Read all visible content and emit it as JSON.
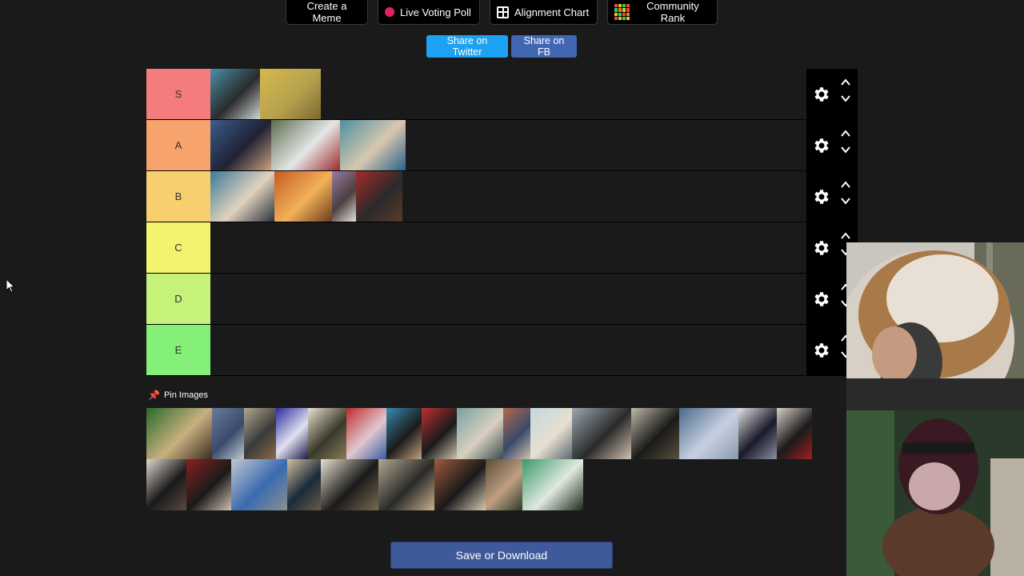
{
  "nav": [
    {
      "label": "Create a Meme",
      "icon": "none"
    },
    {
      "label": "Live Voting Poll",
      "icon": "record-dot-icon"
    },
    {
      "label": "Alignment Chart",
      "icon": "grid-icon"
    },
    {
      "label": "Community Rank",
      "icon": "mosaic-icon"
    }
  ],
  "share": {
    "twitter": "Share on Twitter",
    "facebook": "Share on FB"
  },
  "tiers": [
    {
      "label": "S",
      "color": "#f47c7c",
      "items": [
        {
          "colors": [
            "#4a90a8",
            "#2b2b2b",
            "#cfd6d8"
          ],
          "w": 62
        },
        {
          "colors": [
            "#d6b84a",
            "#b7a24e",
            "#7d6a2e"
          ],
          "w": 76
        }
      ]
    },
    {
      "label": "A",
      "color": "#f7a36c",
      "items": [
        {
          "colors": [
            "#3c5c8c",
            "#1f2233",
            "#c9a27f"
          ],
          "w": 76
        },
        {
          "colors": [
            "#5a6e50",
            "#e6e6e6",
            "#9a2a2a"
          ],
          "w": 86
        },
        {
          "colors": [
            "#4f8fa0",
            "#d8c8b0",
            "#2b5f8a"
          ],
          "w": 82
        }
      ]
    },
    {
      "label": "B",
      "color": "#f7cf6f",
      "items": [
        {
          "colors": [
            "#3a7a9a",
            "#e2d2bc",
            "#2a3040"
          ],
          "w": 80
        },
        {
          "colors": [
            "#c65a22",
            "#f2b25a",
            "#6a3a1a"
          ],
          "w": 72
        },
        {
          "colors": [
            "#9a7aa0",
            "#4a4040",
            "#e6e0d8"
          ],
          "w": 30
        },
        {
          "colors": [
            "#a82a2a",
            "#2a2a2a",
            "#5a3a2a"
          ],
          "w": 58
        }
      ]
    },
    {
      "label": "C",
      "color": "#f4f36f",
      "items": []
    },
    {
      "label": "D",
      "color": "#c6f27a",
      "items": []
    },
    {
      "label": "E",
      "color": "#84f078",
      "items": []
    }
  ],
  "pin_title": "Pin Images",
  "pins": [
    {
      "colors": [
        "#2a6a2a",
        "#c8b080",
        "#3a2a20"
      ],
      "w": 82
    },
    {
      "colors": [
        "#6a7a9a",
        "#3a4a6a",
        "#c0c8d0"
      ],
      "w": 40
    },
    {
      "colors": [
        "#b0a890",
        "#3a3a3a",
        "#8a6a4a"
      ],
      "w": 40
    },
    {
      "colors": [
        "#2a2aa0",
        "#e0e0f0",
        "#1a1a4a"
      ],
      "w": 40
    },
    {
      "colors": [
        "#e8e0d0",
        "#3a3a2a",
        "#8a7a5a"
      ],
      "w": 48
    },
    {
      "colors": [
        "#c02a2a",
        "#e0c8d0",
        "#3a5aa0"
      ],
      "w": 50
    },
    {
      "colors": [
        "#3a8ab0",
        "#1a1a1a",
        "#c0a080"
      ],
      "w": 44
    },
    {
      "colors": [
        "#c03030",
        "#1a1a1a",
        "#d0c0b0"
      ],
      "w": 44
    },
    {
      "colors": [
        "#7aa0a0",
        "#d8d0c0",
        "#3a4a4a"
      ],
      "w": 58
    },
    {
      "colors": [
        "#b06a4a",
        "#3a4a6a",
        "#d0c0b0"
      ],
      "w": 34
    },
    {
      "colors": [
        "#c0d8e0",
        "#e8e0d0",
        "#5a6a70"
      ],
      "w": 52
    },
    {
      "colors": [
        "#9aa8b0",
        "#2a2a2a",
        "#d0c0b0"
      ],
      "w": 74
    },
    {
      "colors": [
        "#c0b8a8",
        "#1a1a1a",
        "#5a5040"
      ],
      "w": 60
    },
    {
      "colors": [
        "#4a6a8a",
        "#c8d0e0",
        "#8a9ab0"
      ],
      "w": 74
    },
    {
      "colors": [
        "#e0e0e0",
        "#1a1a2a",
        "#8a90a0"
      ],
      "w": 48
    },
    {
      "colors": [
        "#d8d0c8",
        "#1a1a1a",
        "#a02020"
      ],
      "w": 44
    },
    {
      "colors": [
        "#e0d8d0",
        "#1a1a1a",
        "#5a4a40"
      ],
      "w": 50
    },
    {
      "colors": [
        "#8a2020",
        "#1a1a1a",
        "#d0c0b0"
      ],
      "w": 56
    },
    {
      "colors": [
        "#c0c8d0",
        "#3a6ab0",
        "#8a9090"
      ],
      "w": 70
    },
    {
      "colors": [
        "#d0c0a0",
        "#1a2a3a",
        "#6a5a4a"
      ],
      "w": 42
    },
    {
      "colors": [
        "#e8e0d0",
        "#1a1a1a",
        "#7a6a50"
      ],
      "w": 72
    },
    {
      "colors": [
        "#b0a890",
        "#2a2a2a",
        "#c8b090"
      ],
      "w": 70
    },
    {
      "colors": [
        "#a05a3a",
        "#1a1a1a",
        "#d8c8b0"
      ],
      "w": 64
    },
    {
      "colors": [
        "#5a4a3a",
        "#c0a080",
        "#2a3a2a"
      ],
      "w": 46
    },
    {
      "colors": [
        "#3a9a6a",
        "#e0e8e0",
        "#1a2a1a"
      ],
      "w": 76
    }
  ],
  "save_button": "Save or Download"
}
